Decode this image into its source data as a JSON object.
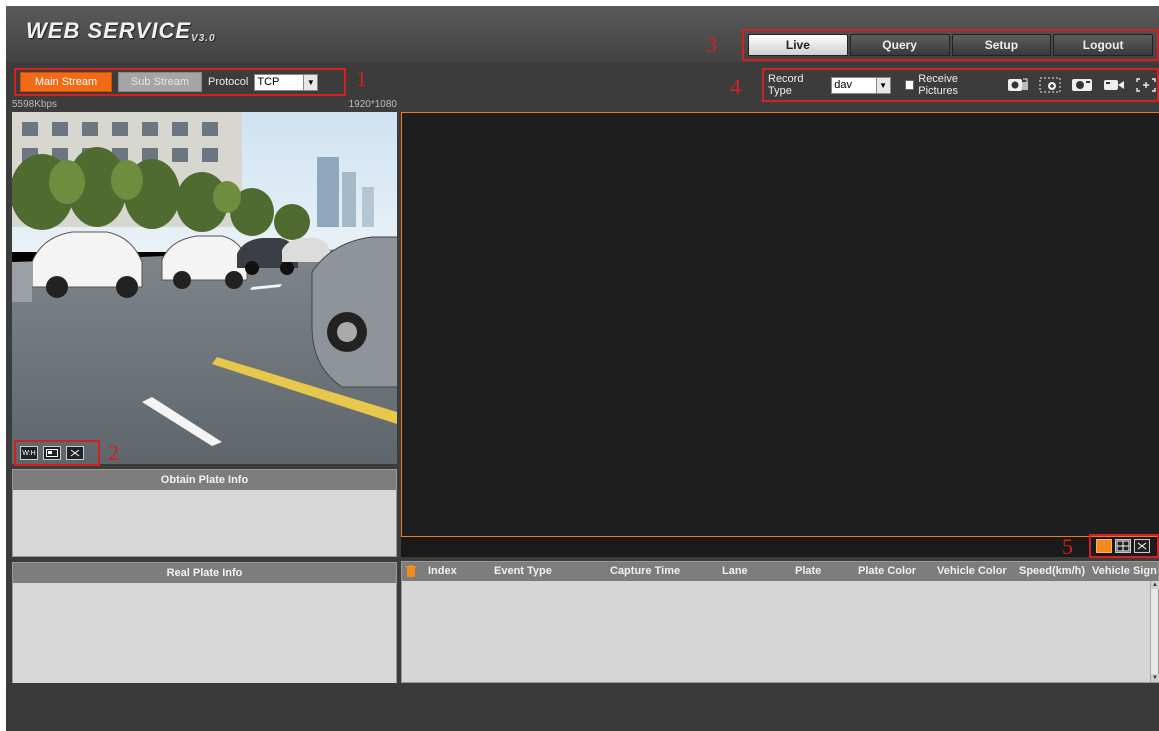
{
  "header": {
    "logo": "WEB SERVICE",
    "version": "V3.0"
  },
  "nav": {
    "tabs": [
      {
        "label": "Live",
        "active": true
      },
      {
        "label": "Query",
        "active": false
      },
      {
        "label": "Setup",
        "active": false
      },
      {
        "label": "Logout",
        "active": false
      }
    ]
  },
  "stream": {
    "main_label": "Main Stream",
    "sub_label": "Sub Stream",
    "protocol_label": "Protocol",
    "protocol_value": "TCP"
  },
  "record": {
    "type_label": "Record Type",
    "type_value": "dav",
    "receive_pictures_label": "Receive Pictures",
    "receive_pictures_checked": false
  },
  "video": {
    "bitrate": "5598Kbps",
    "resolution": "1920*1080"
  },
  "panels": {
    "obtain_title": "Obtain Plate Info",
    "real_title": "Real Plate Info"
  },
  "table": {
    "columns": [
      "Index",
      "Event Type",
      "Capture Time",
      "Lane",
      "Plate",
      "Plate Color",
      "Vehicle Color",
      "Speed(km/h)",
      "Vehicle Sign"
    ],
    "rows": []
  },
  "markers": [
    "1",
    "2",
    "3",
    "4",
    "5"
  ],
  "colors": {
    "accent": "#f26a16",
    "highlight_box": "#d42020",
    "view_border": "#f07a1a",
    "background": "#3c3c3c"
  }
}
